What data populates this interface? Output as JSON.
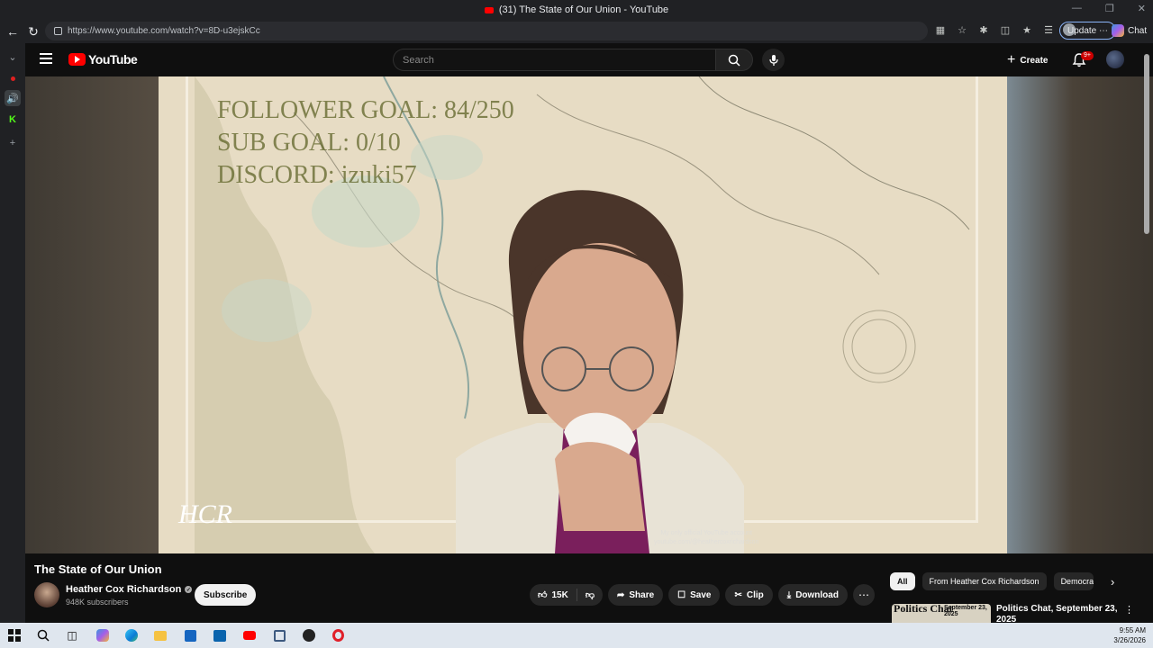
{
  "browser": {
    "window_title": "(31) The State of Our Union - YouTube",
    "url": "https://www.youtube.com/watch?v=8D-u3ejskCc",
    "update_label": "Update",
    "chat_label": "Chat"
  },
  "youtube": {
    "logo_text": "YouTube",
    "search_placeholder": "Search",
    "create_label": "Create",
    "notification_badge": "9+"
  },
  "video": {
    "overlay_lines": [
      "FOLLOWER GOAL:  84/250",
      "SUB GOAL: 0/10",
      "DISCORD: izuki57"
    ],
    "signature": "HCR",
    "watermark_line1": "My only official YouTube account",
    "watermark_line2": "youtube.com/@heathercoxrichardson",
    "title": "The State of Our Union",
    "channel_name": "Heather Cox Richardson",
    "subscribers": "948K subscribers",
    "subscribe_label": "Subscribe",
    "likes": "15K",
    "share_label": "Share",
    "save_label": "Save",
    "clip_label": "Clip",
    "download_label": "Download"
  },
  "sidebar": {
    "chips": [
      "All",
      "From Heather Cox Richardson",
      "Democracy"
    ],
    "rec_title": "Politics Chat, September 23, 2025",
    "rec_thumb_title": "Politics Chat",
    "rec_thumb_date": "September 23, 2025"
  },
  "taskbar": {
    "time": "9:55 AM",
    "date": "3/26/2026"
  }
}
